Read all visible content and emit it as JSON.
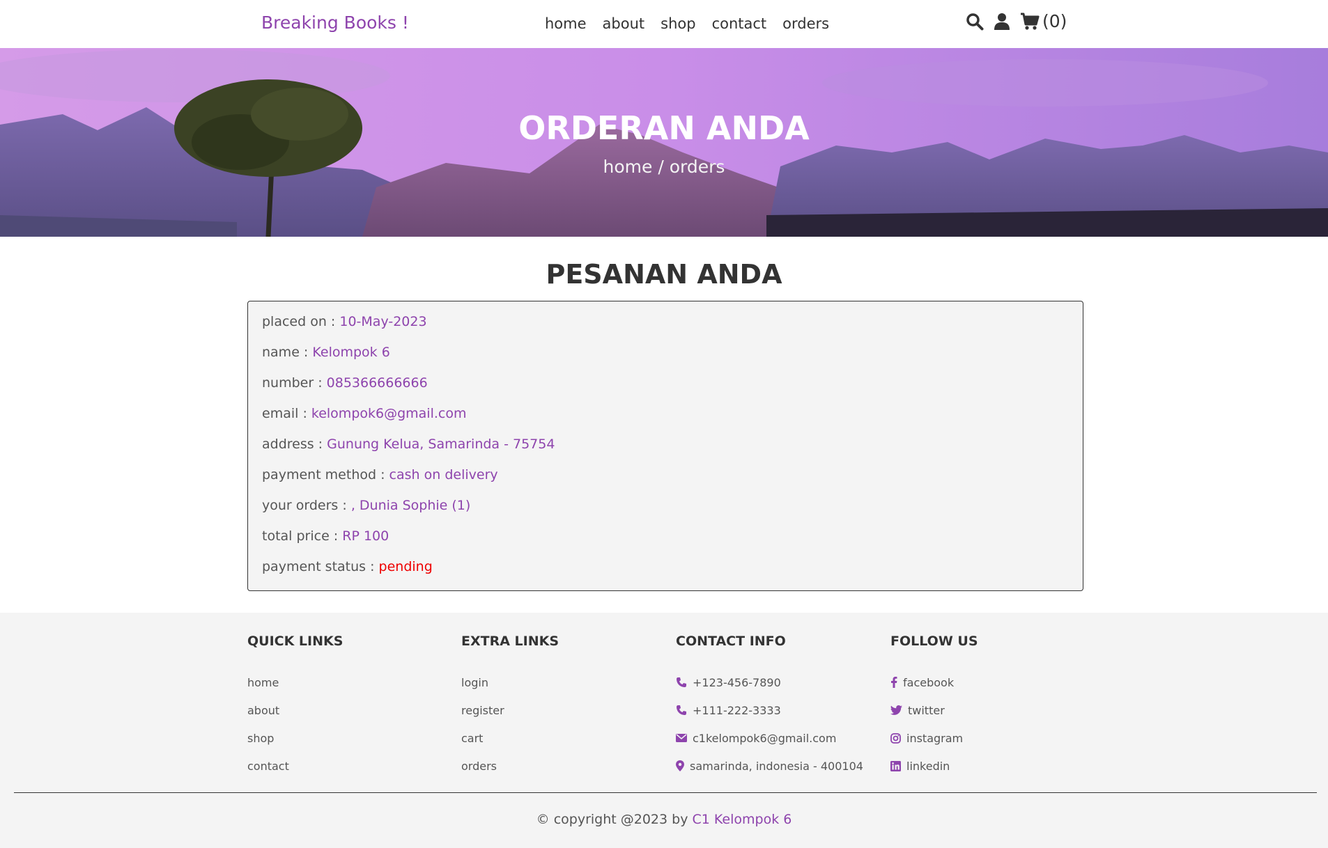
{
  "header": {
    "logo": "Breaking Books !",
    "nav": [
      "home",
      "about",
      "shop",
      "contact",
      "orders"
    ],
    "icons": [
      "search-icon",
      "user-icon",
      "cart-icon"
    ],
    "cart_count": "(0)"
  },
  "banner": {
    "title": "ORDERAN ANDA",
    "crumb_home": "home",
    "crumb_sep": " / ",
    "crumb_current": "orders"
  },
  "orders": {
    "section_title": "PESANAN ANDA",
    "rows": [
      {
        "label": "placed on : ",
        "value": "10-May-2023"
      },
      {
        "label": "name : ",
        "value": "Kelompok 6"
      },
      {
        "label": "number : ",
        "value": "085366666666"
      },
      {
        "label": "email : ",
        "value": "kelompok6@gmail.com"
      },
      {
        "label": "address : ",
        "value": "Gunung Kelua, Samarinda - 75754"
      },
      {
        "label": "payment method : ",
        "value": "cash on delivery"
      },
      {
        "label": "your orders : ",
        "value": ", Dunia Sophie (1)"
      },
      {
        "label": "total price : ",
        "value": "RP 100"
      },
      {
        "label": "payment status : ",
        "value": "pending"
      }
    ],
    "status_color": "#ee0000"
  },
  "footer": {
    "quick_links": {
      "title": "QUICK LINKS",
      "items": [
        "home",
        "about",
        "shop",
        "contact"
      ]
    },
    "extra_links": {
      "title": "EXTRA LINKS",
      "items": [
        "login",
        "register",
        "cart",
        "orders"
      ]
    },
    "contact_info": {
      "title": "CONTACT INFO",
      "items": [
        {
          "icon": "phone-icon",
          "text": "+123-456-7890"
        },
        {
          "icon": "phone-icon",
          "text": "+111-222-3333"
        },
        {
          "icon": "envelope-icon",
          "text": "c1kelompok6@gmail.com"
        },
        {
          "icon": "map-marker-icon",
          "text": "samarinda, indonesia - 400104"
        }
      ]
    },
    "follow_us": {
      "title": "FOLLOW US",
      "items": [
        {
          "icon": "facebook-icon",
          "text": "facebook"
        },
        {
          "icon": "twitter-icon",
          "text": "twitter"
        },
        {
          "icon": "instagram-icon",
          "text": "instagram"
        },
        {
          "icon": "linkedin-icon",
          "text": "linkedin"
        }
      ]
    },
    "credit_prefix": "© copyright @2023 by ",
    "credit_name": "C1 Kelompok 6"
  },
  "colors": {
    "accent": "#8e44ad",
    "text": "#333333",
    "footer_bg": "#f4f4f4"
  }
}
